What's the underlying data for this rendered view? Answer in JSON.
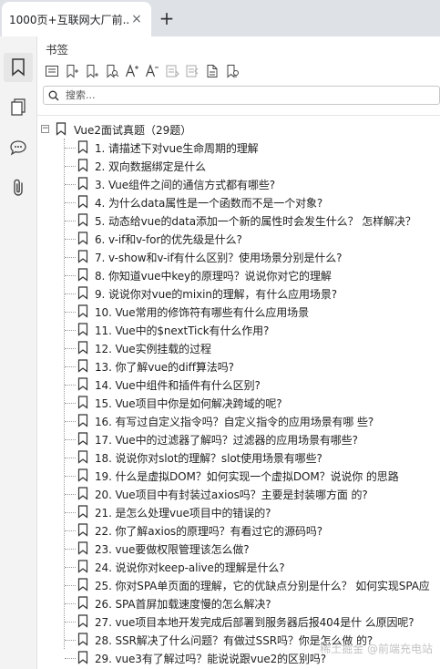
{
  "tab": {
    "title": "1000页+互联网大厂前...",
    "close": "×",
    "new_tab": "+"
  },
  "rail": {
    "items": [
      {
        "name": "bookmark-icon",
        "active": true
      },
      {
        "name": "pages-icon",
        "active": false
      },
      {
        "name": "comment-icon",
        "active": false
      },
      {
        "name": "attachment-icon",
        "active": false
      }
    ]
  },
  "panel": {
    "title": "书签",
    "search_placeholder": "搜索...",
    "toolbar": [
      "expand-all-icon",
      "add-bookmark-icon",
      "add-child-bookmark-icon",
      "find-bookmark-icon",
      "increase-font-icon",
      "decrease-font-icon",
      "bookmark-prev-icon",
      "bookmark-next-icon",
      "bookmark-properties-icon",
      "bookmark-goto-icon"
    ]
  },
  "tree": {
    "root_toggle": "−",
    "root_label": "Vue2面试真题（29题）",
    "items": [
      "1. 请描述下对vue生命周期的理解",
      "2. 双向数据绑定是什么",
      "3. Vue组件之间的通信方式都有哪些?",
      "4. 为什么data属性是一个函数而不是一个对象?",
      "5. 动态给vue的data添加一个新的属性时会发生什么？ 怎样解决？",
      "6. v-if和v-for的优先级是什么?",
      "7. v-show和v-if有什么区别？使用场景分别是什么?",
      "8. 你知道vue中key的原理吗？说说你对它的理解",
      "9. 说说你对vue的mixin的理解，有什么应用场景?",
      "10. Vue常用的修饰符有哪些有什么应用场景",
      "11. Vue中的$nextTick有什么作用?",
      "12. Vue实例挂载的过程",
      "13. 你了解vue的diff算法吗?",
      "14. Vue中组件和插件有什么区别?",
      "15. Vue项目中你是如何解决跨域的呢?",
      "16. 有写过自定义指令吗？自定义指令的应用场景有哪 些?",
      "17. Vue中的过滤器了解吗？过滤器的应用场景有哪些?",
      "18. 说说你对slot的理解？slot使用场景有哪些?",
      "19. 什么是虚拟DOM？如何实现一个虚拟DOM？说说你 的思路",
      "20. Vue项目中有封装过axios吗？主要是封装哪方面 的?",
      "21. 是怎么处理vue项目中的错误的?",
      "22. 你了解axios的原理吗？有看过它的源码吗?",
      "23. vue要做权限管理该怎么做?",
      "24. 说说你对keep-alive的理解是什么?",
      "25. 你对SPA单页面的理解，它的优缺点分别是什么？ 如何实现SPA应",
      "26. SPA首屏加载速度慢的怎么解决?",
      "27. vue项目本地开发完成后部署到服务器后报404是什 么原因呢?",
      "28. SSR解决了什么问题？有做过SSR吗？你是怎么做 的?",
      "29. vue3有了解过吗？能说说跟vue2的区别吗?"
    ]
  },
  "watermark": "稀土掘金 @前端充电站"
}
